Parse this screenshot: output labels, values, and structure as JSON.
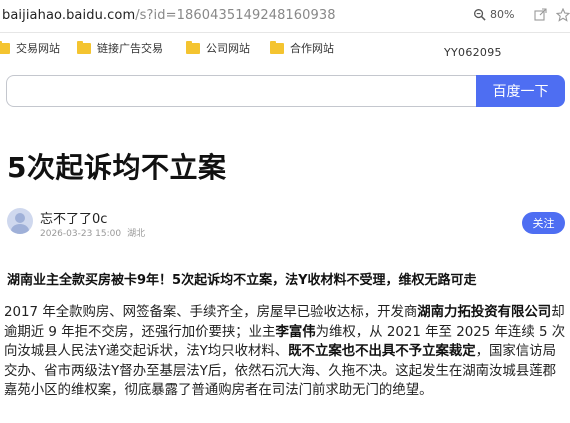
{
  "browser": {
    "url_host": "baijiahao.baidu.com",
    "url_path": "/s?id=1860435149248160938",
    "zoom": "80%"
  },
  "bookmarks": [
    "交易网站",
    "链接广告交易",
    "公司网站",
    "合作网站"
  ],
  "watermark": "YY062095",
  "search": {
    "button": "百度一下",
    "value": ""
  },
  "article": {
    "title": "5次起诉均不立案",
    "author": "忘不了了0c",
    "date": "2026-03-23 15:00",
    "location": "湖北",
    "follow": "关注",
    "lead": "湖南业主全款买房被卡9年！5次起诉均不立案，法Y收材料不受理，维权无路可走",
    "body": {
      "p1": "2017 年全款购房、网签备案、手续齐全，房屋早已验收达标，开发商",
      "p2": "湖南力拓投资有限公司",
      "p3": "却逾期近 9 年拒不交房，还强行加价要挟；业主",
      "p4": "李富伟",
      "p5": "为维权，从 2021 年至 2025 年连续 5 次向汝城县人民法Y递交起诉状，法Y均只收材料、",
      "p6": "既不立案也不出具不予立案裁定",
      "p7": "，国家信访局交办、省市两级法Y督办至基层法Y后，依然石沉大海、久拖不决。这起发生在湖南汝城县莲郡嘉苑小区的维权案，彻底暴露了普通购房者在司法门前求助无门的绝望。"
    }
  },
  "colors": {
    "accent": "#4e6ef2",
    "folder": "#f4c430"
  }
}
